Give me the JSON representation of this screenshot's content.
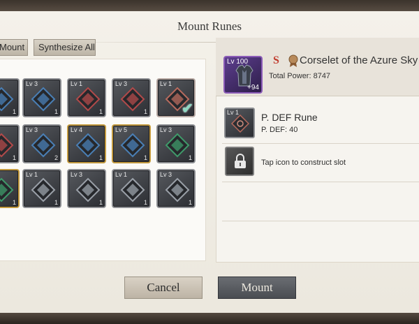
{
  "dialog": {
    "title": "Mount Runes"
  },
  "tabs": {
    "mount_label": "Mount",
    "synthesize_label": "Synthesize All"
  },
  "grid": {
    "slots": [
      {
        "lv": "",
        "count": "1",
        "color": "#4a7fb5",
        "style": "normal"
      },
      {
        "lv": "Lv 3",
        "count": "1",
        "color": "#4a7fb5",
        "style": "normal"
      },
      {
        "lv": "Lv 1",
        "count": "1",
        "color": "#b24a4a",
        "style": "normal"
      },
      {
        "lv": "Lv 3",
        "count": "1",
        "color": "#b24a4a",
        "style": "normal"
      },
      {
        "lv": "Lv 1",
        "count": "",
        "color": "#b86b5e",
        "style": "selected"
      },
      {
        "lv": "",
        "count": "1",
        "color": "#b24a4a",
        "style": "normal"
      },
      {
        "lv": "Lv 3",
        "count": "2",
        "color": "#4a7fb5",
        "style": "normal"
      },
      {
        "lv": "Lv 4",
        "count": "1",
        "color": "#4a7fb5",
        "style": "gold"
      },
      {
        "lv": "Lv 5",
        "count": "1",
        "color": "#4a7fb5",
        "style": "gold"
      },
      {
        "lv": "Lv 3",
        "count": "1",
        "color": "#3f9a6a",
        "style": "normal"
      },
      {
        "lv": "",
        "count": "1",
        "color": "#3f9a6a",
        "style": "gold"
      },
      {
        "lv": "Lv 1",
        "count": "1",
        "color": "#9aa0a8",
        "style": "normal"
      },
      {
        "lv": "Lv 3",
        "count": "1",
        "color": "#9aa0a8",
        "style": "normal"
      },
      {
        "lv": "Lv 1",
        "count": "1",
        "color": "#9aa0a8",
        "style": "normal"
      },
      {
        "lv": "Lv 3",
        "count": "1",
        "color": "#9aa0a8",
        "style": "normal"
      }
    ]
  },
  "equipment": {
    "lv": "Lv 100",
    "enhance": "+94",
    "grade": "S",
    "name": "Corselet of the Azure Sky",
    "power": "Total Power: 8747"
  },
  "rune": {
    "lv": "Lv 1",
    "name": "P. DEF Rune",
    "stat": "P. DEF: 40"
  },
  "slot_locked": {
    "text": "Tap icon to construct slot"
  },
  "buttons": {
    "cancel": "Cancel",
    "mount": "Mount"
  }
}
